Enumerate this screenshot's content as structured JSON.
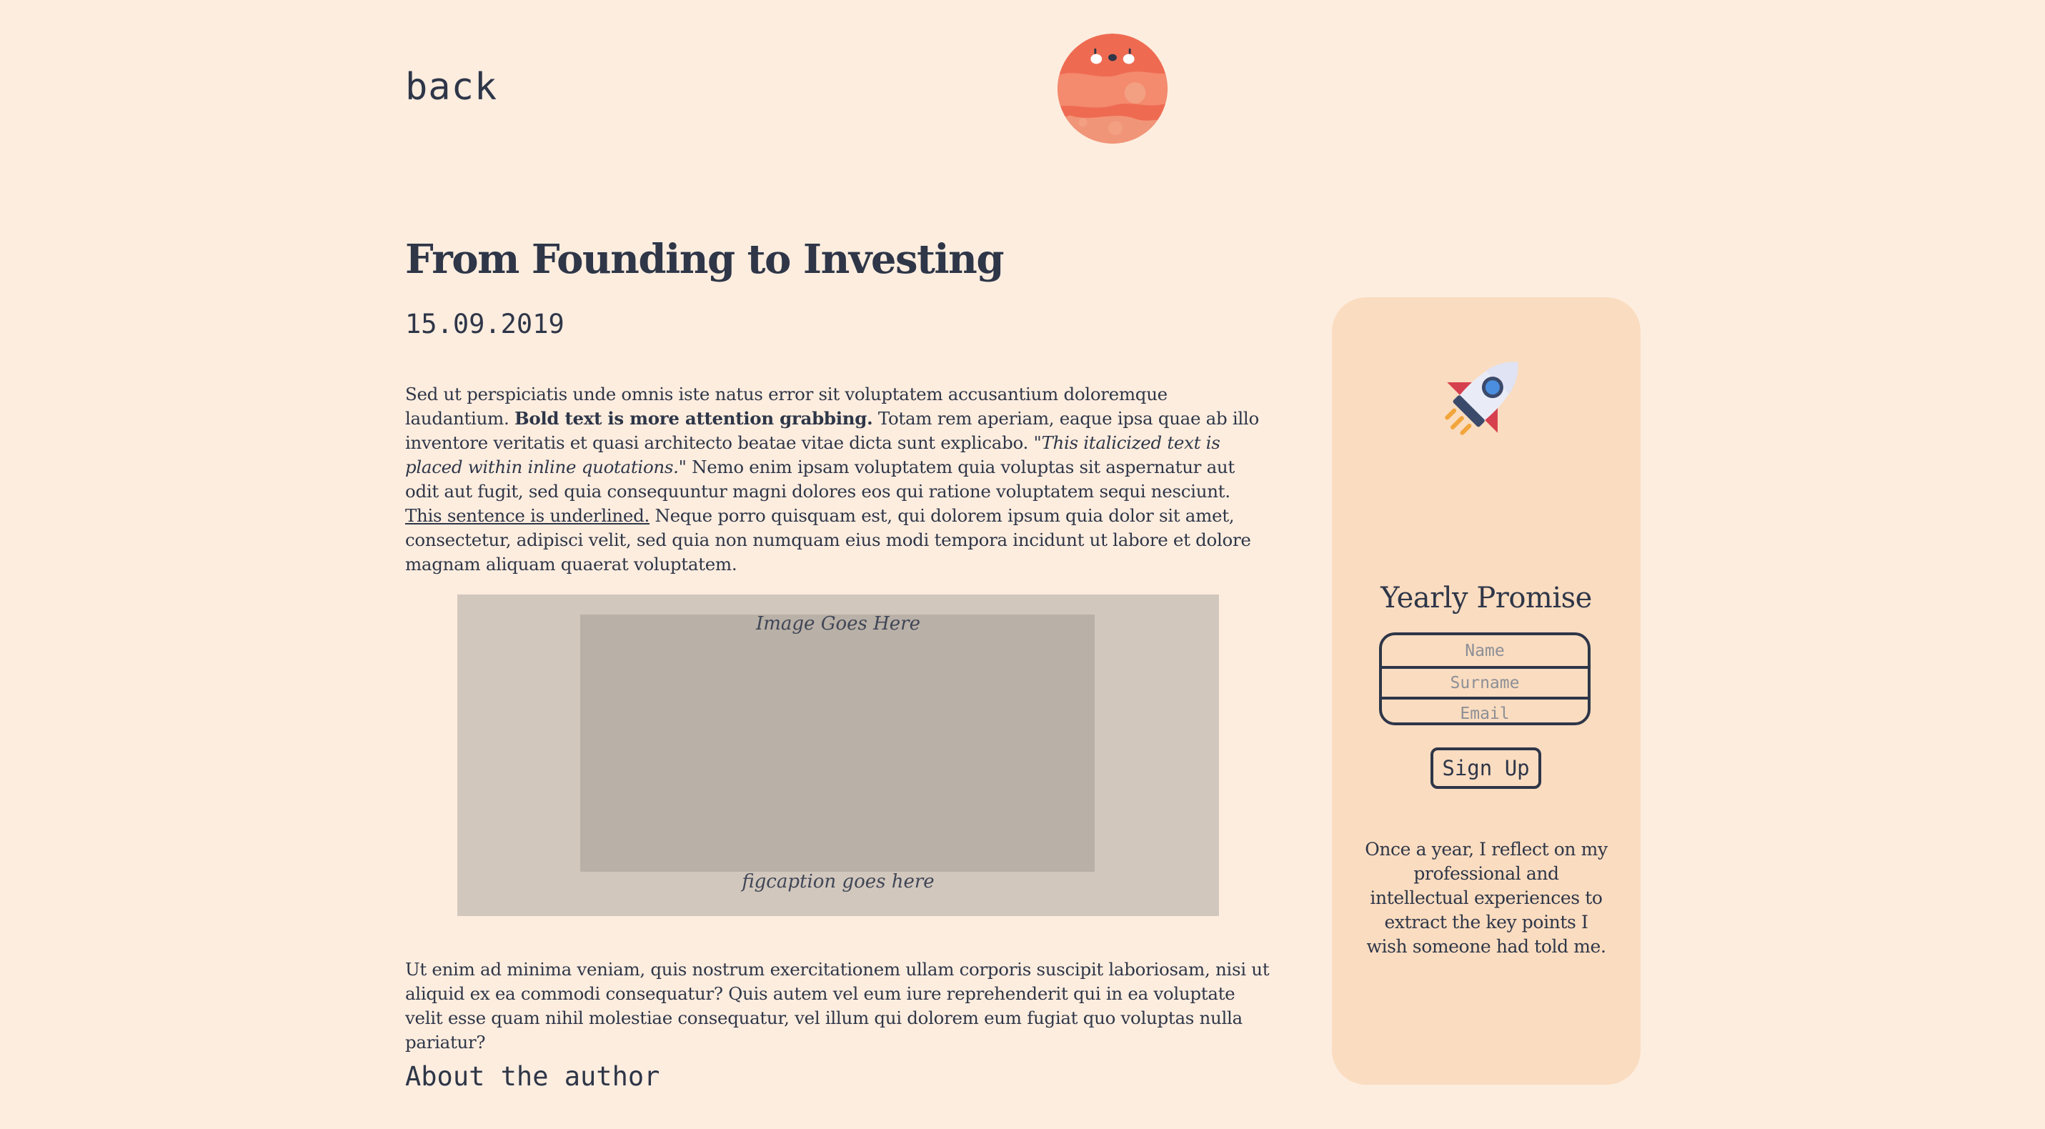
{
  "nav": {
    "back_label": "back"
  },
  "logo": {
    "icon": "planet-face-icon",
    "color": "#ee6b52"
  },
  "article": {
    "title": "From Founding to Investing",
    "date": "15.09.2019",
    "p1_a": "Sed ut perspiciatis unde omnis iste natus error sit voluptatem accusantium doloremque laudantium. ",
    "p1_bold": "Bold text is more attention grabbing.",
    "p1_b": " Totam rem aperiam, eaque ipsa quae ab illo inventore veritatis et quasi architecto beatae vitae dicta sunt explicabo. \"",
    "p1_italic": "This italicized text is placed within inline quotations.",
    "p1_c": "\" Nemo enim ipsam voluptatem quia voluptas sit aspernatur aut odit aut fugit, sed quia consequuntur magni dolores eos qui ratione voluptatem sequi nesciunt. ",
    "p1_underline": "This sentence is underlined.",
    "p1_d": " Neque porro quisquam est, qui dolorem ipsum quia dolor sit amet, consectetur, adipisci velit, sed quia non numquam eius modi tempora incidunt ut labore et dolore magnam aliquam quaerat voluptatem.",
    "figure": {
      "image_placeholder": "Image Goes Here",
      "caption": "figcaption goes here"
    },
    "p2": "Ut enim ad minima veniam, quis nostrum exercitationem ullam corporis suscipit laboriosam, nisi ut aliquid ex ea commodi consequatur? Quis autem vel eum iure reprehenderit qui in ea voluptate velit esse quam nihil molestiae consequatur, vel illum qui dolorem eum fugiat quo voluptas nulla pariatur?",
    "about_heading": "About the author"
  },
  "sidebar": {
    "icon": "rocket-icon",
    "title": "Yearly Promise",
    "form": {
      "name_placeholder": "Name",
      "surname_placeholder": "Surname",
      "email_placeholder": "Email"
    },
    "signup_label": "Sign Up",
    "description": "Once a year, I reflect on my professional and intellectual experiences to extract the key points I wish someone had told me."
  },
  "colors": {
    "background": "#fdeddf",
    "sidebar": "#fadcc0",
    "text": "#2e3648",
    "figure_bg": "#d2c7bd",
    "image_bg": "#b9b0a7"
  }
}
